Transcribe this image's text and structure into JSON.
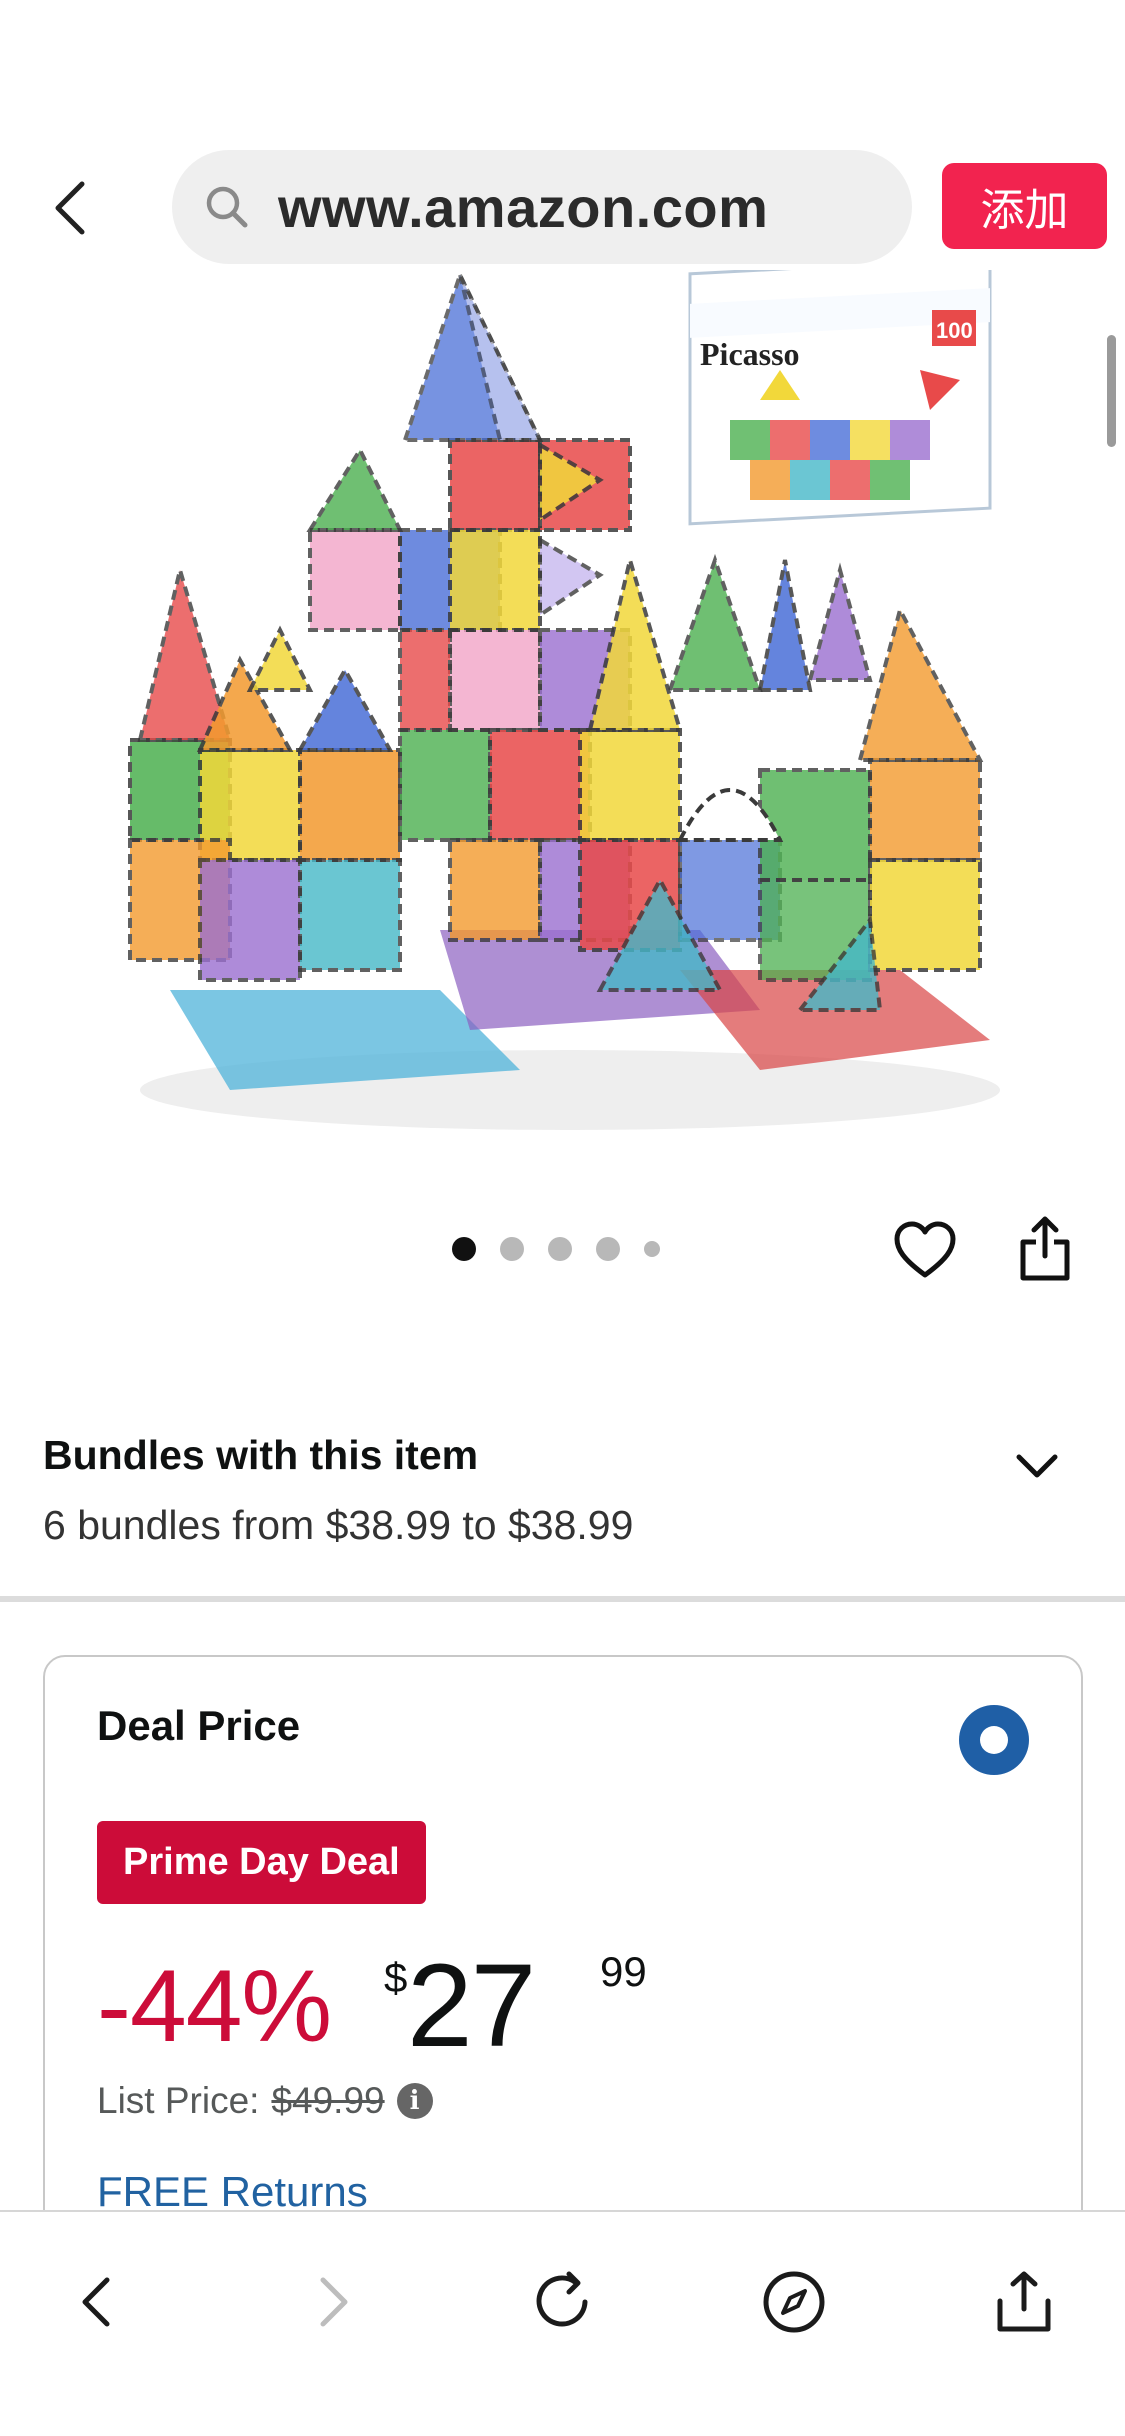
{
  "topbar": {
    "url": "www.amazon.com",
    "add_label": "添加",
    "colors": {
      "add_button": "#f2234f",
      "urlbar_bg": "#efefef"
    }
  },
  "carousel": {
    "dots": 5,
    "active_index": 0
  },
  "bundles": {
    "title": "Bundles with this item",
    "subtitle": "6 bundles from $38.99 to $38.99"
  },
  "deal": {
    "title": "Deal Price",
    "badge": "Prime Day Deal",
    "discount": "-44%",
    "currency": "$",
    "price_whole": "27",
    "price_fraction": "99",
    "list_label": "List Price:",
    "list_price": "$49.99",
    "returns": "FREE Returns",
    "colors": {
      "badge": "#cc0c39",
      "discount": "#cc0c39",
      "radio": "#1f5fa6",
      "link": "#2162a1"
    }
  },
  "product_image": {
    "box_brand": "Picasso",
    "box_count": "100"
  },
  "icons": {
    "back": "chevron-left-icon",
    "search": "search-icon",
    "wishlist": "heart-icon",
    "share": "share-icon",
    "expand": "chevron-down-icon",
    "info": "info-icon",
    "reload": "reload-icon",
    "compass": "compass-icon"
  }
}
